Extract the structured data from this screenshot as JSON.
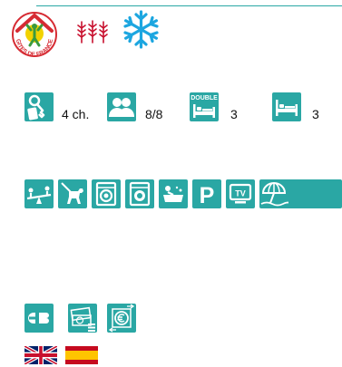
{
  "capacity": {
    "rooms_label": "4 ch.",
    "persons_label": "8/8",
    "double_badge": "DOUBLE",
    "double_beds_count": "3",
    "single_beds_count": "3"
  },
  "equipment": {
    "parking_letter": "P",
    "tv_letters": "TV"
  },
  "payment": {
    "cb_letters": "CB"
  },
  "header": {
    "logo_ring_text": "GITES DE FRANCE"
  },
  "icons": {
    "header": [
      "gites-de-france-logo",
      "wheat-ears-icon",
      "snowflake-icon"
    ],
    "capacity": [
      "key-icon",
      "persons-icon",
      "double-bed-icon",
      "single-bed-icon"
    ],
    "equipment": [
      "playground-seesaw-icon",
      "pets-allowed-icon",
      "washing-machine-icon",
      "dishwasher-icon",
      "baby-bath-icon",
      "parking-icon",
      "tv-icon",
      "beach-umbrella-icon"
    ],
    "payment": [
      "credit-card-icon",
      "cheques-icon",
      "holiday-vouchers-icon"
    ],
    "languages": [
      "flag-uk",
      "flag-spain"
    ]
  },
  "colors": {
    "tile": "#2aa7a4",
    "logo_red": "#d62b33",
    "logo_green": "#3a9a3f",
    "wheat_red": "#c8102e",
    "snow_blue": "#1ca6e0",
    "spain_red": "#c60b1e",
    "spain_yellow": "#ffc400",
    "uk_blue": "#012169"
  }
}
